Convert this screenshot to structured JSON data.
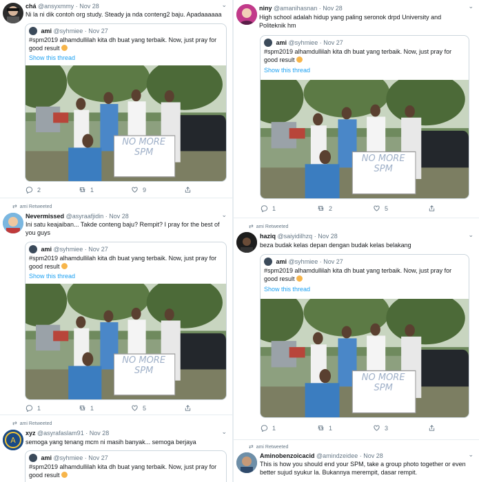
{
  "colors": {
    "accent": "#1da1f2",
    "text": "#14171a",
    "muted": "#657786",
    "border": "#e6ecf0"
  },
  "quoted": {
    "name": "ami",
    "handle": "@syhmiee",
    "date": "Nov 27",
    "text": "#spm2019 alhamdullilah kita dh buat yang terbaik. Now, just pray for good result",
    "show_thread": "Show this thread",
    "sign_text": "NO MORE SPM",
    "photo_icon": "group-photo"
  },
  "retweet_label": "ami Retweeted",
  "left": [
    {
      "name": "chá",
      "handle": "@ansyxmmy",
      "sep": "·",
      "date": "Nov 28",
      "text": "Ni la ni dik contoh org study. Steady ja nda conteng2 baju. Apadaaaaaa",
      "replies": "2",
      "retweets": "1",
      "likes": "9"
    },
    {
      "retweeted_by": "ami Retweeted",
      "name": "Nevermissed",
      "handle": "@asyraafjidin",
      "sep": "·",
      "date": "Nov 28",
      "text": "Ini satu keajaiban... Takde conteng baju? Rempit? I pray for the best of you guys",
      "replies": "1",
      "retweets": "1",
      "likes": "5"
    },
    {
      "retweeted_by": "ami Retweeted",
      "name": "xyz",
      "handle": "@asyrafaslam91",
      "sep": "·",
      "date": "Nov 28",
      "text": "semoga yang tenang mcm ni masih banyak... semoga berjaya"
    }
  ],
  "right": [
    {
      "name": "niny",
      "handle": "@amanihasnan",
      "sep": "·",
      "date": "Nov 28",
      "text": "High school adalah hidup yang paling seronok drpd University and Politeknik hm",
      "replies": "1",
      "retweets": "2",
      "likes": "5"
    },
    {
      "retweeted_by": "ami Retweeted",
      "name": "haziq",
      "handle": "@saiyidilhzq",
      "sep": "·",
      "date": "Nov 28",
      "text": "beza budak kelas depan dengan budak kelas belakang",
      "replies": "1",
      "retweets": "1",
      "likes": "3"
    },
    {
      "retweeted_by": "ami Retweeted",
      "name": "Aminobenzoicacid",
      "handle": "@amindzeidee",
      "sep": "·",
      "date": "Nov 28",
      "text": "This is how you should end your SPM, take a group photo together or even better sujud syukur la. Bukannya merempit, dasar rempit."
    }
  ]
}
